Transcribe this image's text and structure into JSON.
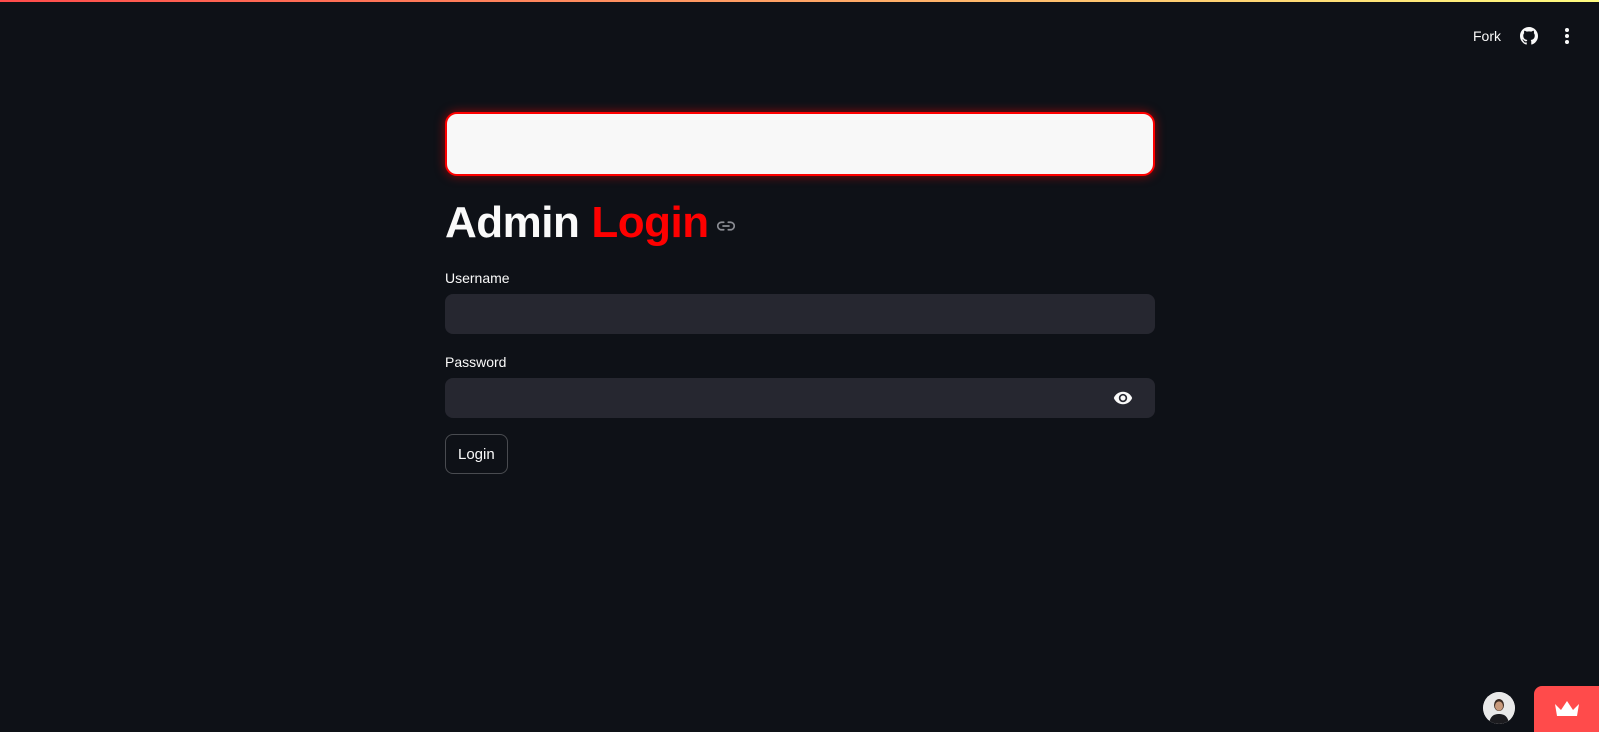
{
  "header": {
    "fork_label": "Fork",
    "github_icon": "github-icon",
    "menu_icon": "more-vertical-icon"
  },
  "banner": {},
  "title": {
    "part1": "Admin",
    "part2": "Login",
    "anchor_icon": "link-icon"
  },
  "form": {
    "username": {
      "label": "Username",
      "value": "",
      "placeholder": ""
    },
    "password": {
      "label": "Password",
      "value": "",
      "placeholder": "",
      "toggle_icon": "eye-icon"
    },
    "submit_label": "Login"
  },
  "footer": {
    "avatar_icon": "user-avatar",
    "badge_icon": "streamlit-crown-icon"
  },
  "colors": {
    "background": "#0e1117",
    "accent": "#ff0000",
    "input_bg": "#262730",
    "badge": "#ff4b4b"
  }
}
